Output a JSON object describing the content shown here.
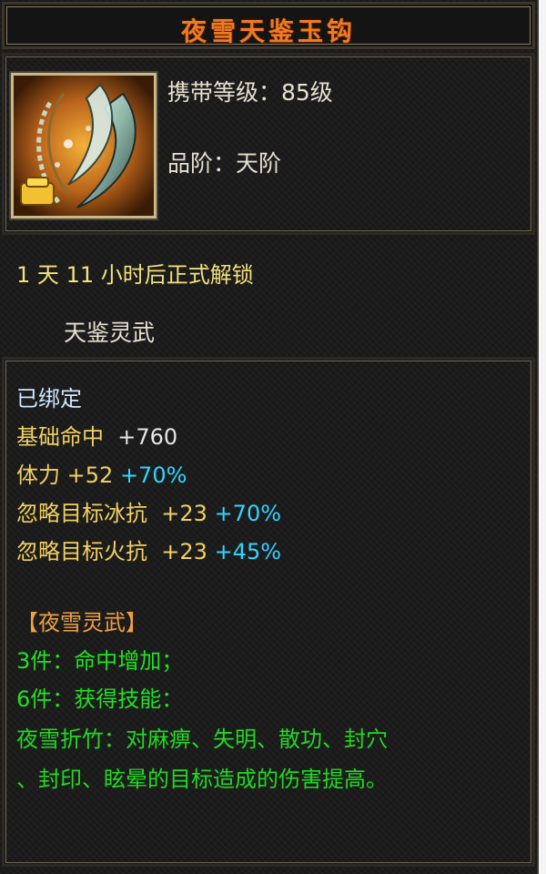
{
  "header": {
    "title": "夜雪天鉴玉钩"
  },
  "info": {
    "level_label": "携带等级：85级",
    "grade_label": "品阶：天阶",
    "icon": "jade-hook-weapon-icon",
    "bound_badge_icon": "gold-ingot-icon"
  },
  "unlock": {
    "days": "1",
    "day_unit": "天",
    "hours": "11",
    "suffix": "小时后正式解锁"
  },
  "series_name": "天鉴灵武",
  "bind_status": "已绑定",
  "stats": [
    {
      "name": "基础命中",
      "value": "+760",
      "bonus": ""
    },
    {
      "name": "体力",
      "value": "+52",
      "bonus": "+70%"
    },
    {
      "name": "忽略目标冰抗",
      "value": "+23",
      "bonus": "+70%"
    },
    {
      "name": "忽略目标火抗",
      "value": "+23",
      "bonus": "+45%"
    }
  ],
  "set": {
    "name": "【夜雪灵武】",
    "bonus_3": "3件：命中增加；",
    "bonus_6": "6件：获得技能：",
    "skill_line1": "夜雪折竹：对麻痹、失明、散功、封穴",
    "skill_line2": "、封印、眩晕的目标造成的伤害提高。"
  },
  "colors": {
    "title": "#f07a22",
    "unlock": "#f2e27a",
    "stat_gold": "#f2d060",
    "bonus_cyan": "#33d3ff",
    "set_orange": "#f0a040",
    "set_green": "#22e022"
  }
}
